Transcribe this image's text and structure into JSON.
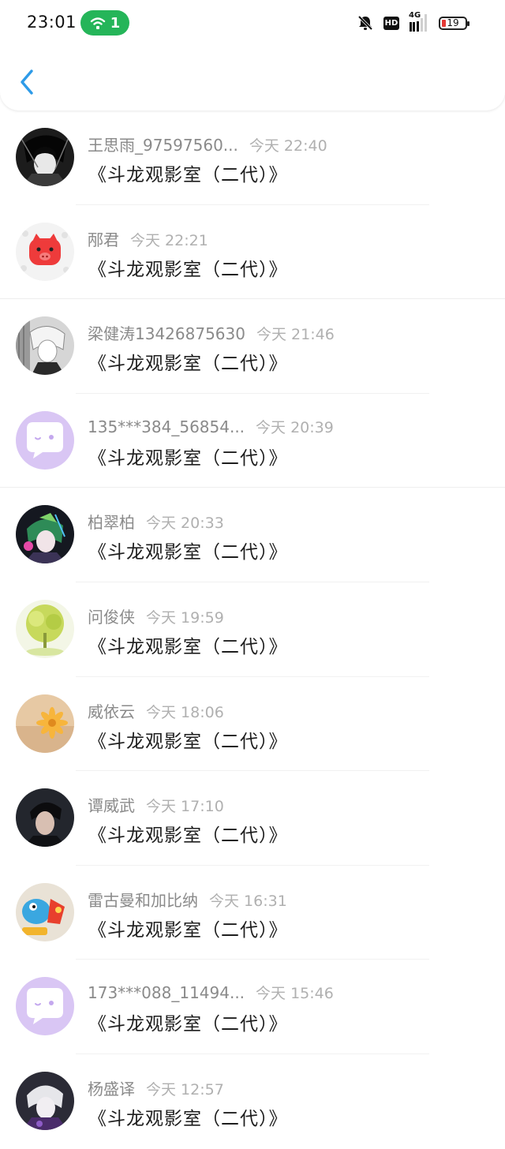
{
  "status_bar": {
    "time": "23:01",
    "wifi_count": "1",
    "hd_label": "HD",
    "network_label": "4G",
    "battery_level": "19"
  },
  "items": [
    {
      "name": "王思雨_97597560...",
      "time": "今天 22:40",
      "message": "《斗龙观影室（二代）》"
    },
    {
      "name": "邴君",
      "time": "今天 22:21",
      "message": "《斗龙观影室（二代）》"
    },
    {
      "name": "梁健涛13426875630",
      "time": "今天 21:46",
      "message": "《斗龙观影室（二代）》"
    },
    {
      "name": "135***384_56854...",
      "time": "今天 20:39",
      "message": "《斗龙观影室（二代）》"
    },
    {
      "name": "柏翠柏",
      "time": "今天 20:33",
      "message": "《斗龙观影室（二代）》"
    },
    {
      "name": "问俊侠",
      "time": "今天 19:59",
      "message": "《斗龙观影室（二代）》"
    },
    {
      "name": "威依云",
      "time": "今天 18:06",
      "message": "《斗龙观影室（二代）》"
    },
    {
      "name": "谭威武",
      "time": "今天 17:10",
      "message": "《斗龙观影室（二代）》"
    },
    {
      "name": "雷古曼和加比纳",
      "time": "今天 16:31",
      "message": "《斗龙观影室（二代）》"
    },
    {
      "name": "173***088_11494...",
      "time": "今天 15:46",
      "message": "《斗龙观影室（二代）》"
    },
    {
      "name": "杨盛译",
      "time": "今天 12:57",
      "message": "《斗龙观影室（二代）》"
    }
  ]
}
